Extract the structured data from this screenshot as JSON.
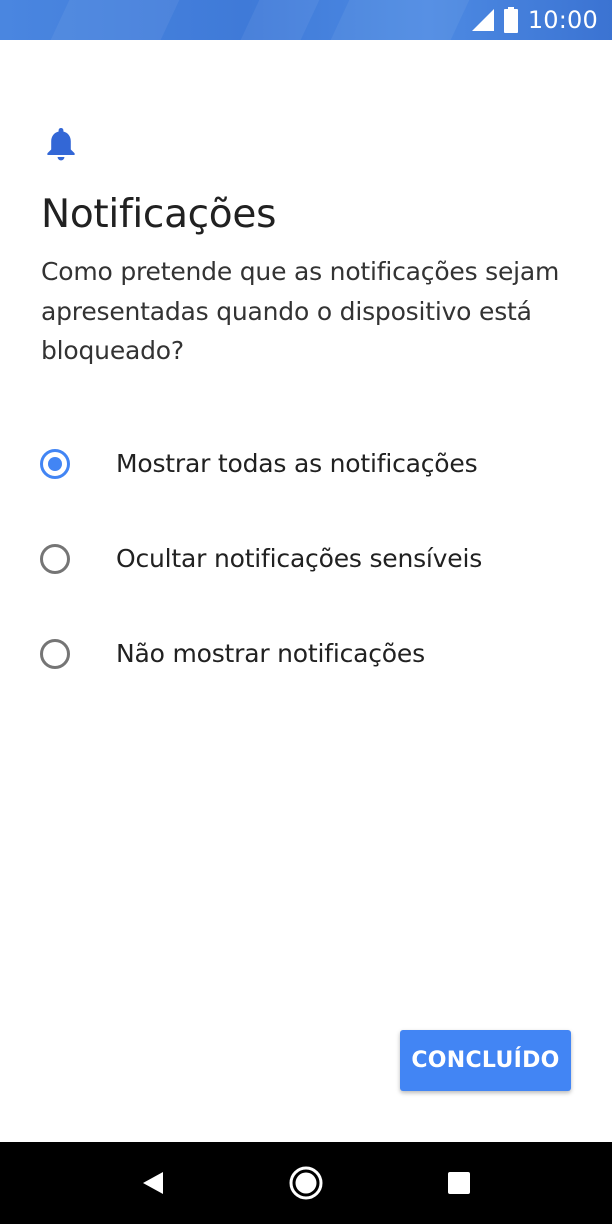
{
  "status_bar": {
    "time": "10:00",
    "signal_icon": "signal-icon",
    "battery_icon": "battery-icon",
    "background_color": "#4a86e0"
  },
  "header": {
    "icon": "bell-icon",
    "icon_color": "#3367d6",
    "title": "Notificações",
    "description": "Como pretende que as notificações sejam apresentadas quando o dispositivo está bloqueado?"
  },
  "options": [
    {
      "label": "Mostrar todas as notificações",
      "selected": true
    },
    {
      "label": "Ocultar notificações sensíveis",
      "selected": false
    },
    {
      "label": "Não mostrar notificações",
      "selected": false
    }
  ],
  "done_button": {
    "label": "CONCLUÍDO",
    "color": "#4285f4"
  },
  "nav_bar": {
    "back_icon": "back-triangle-icon",
    "home_icon": "home-circle-icon",
    "recents_icon": "recents-square-icon"
  },
  "accent_color": "#4285f4"
}
